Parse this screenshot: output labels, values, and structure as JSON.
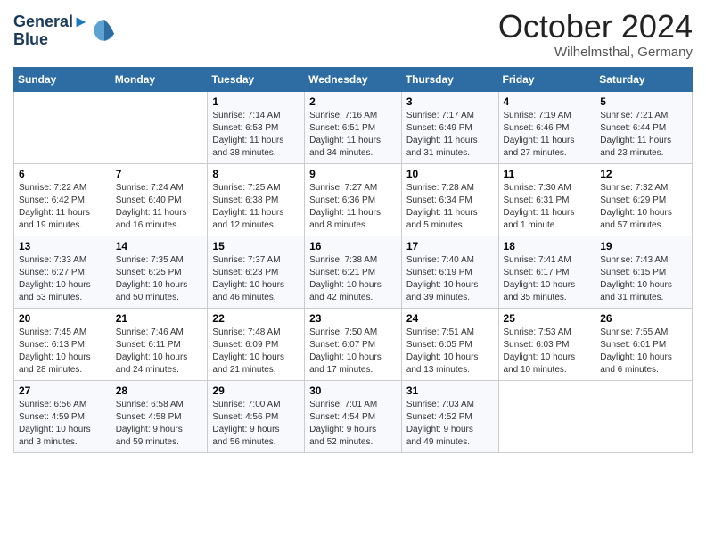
{
  "header": {
    "logo_line1": "General",
    "logo_line2": "Blue",
    "month": "October 2024",
    "location": "Wilhelmsthal, Germany"
  },
  "weekdays": [
    "Sunday",
    "Monday",
    "Tuesday",
    "Wednesday",
    "Thursday",
    "Friday",
    "Saturday"
  ],
  "weeks": [
    [
      {
        "day": "",
        "info": ""
      },
      {
        "day": "",
        "info": ""
      },
      {
        "day": "1",
        "info": "Sunrise: 7:14 AM\nSunset: 6:53 PM\nDaylight: 11 hours\nand 38 minutes."
      },
      {
        "day": "2",
        "info": "Sunrise: 7:16 AM\nSunset: 6:51 PM\nDaylight: 11 hours\nand 34 minutes."
      },
      {
        "day": "3",
        "info": "Sunrise: 7:17 AM\nSunset: 6:49 PM\nDaylight: 11 hours\nand 31 minutes."
      },
      {
        "day": "4",
        "info": "Sunrise: 7:19 AM\nSunset: 6:46 PM\nDaylight: 11 hours\nand 27 minutes."
      },
      {
        "day": "5",
        "info": "Sunrise: 7:21 AM\nSunset: 6:44 PM\nDaylight: 11 hours\nand 23 minutes."
      }
    ],
    [
      {
        "day": "6",
        "info": "Sunrise: 7:22 AM\nSunset: 6:42 PM\nDaylight: 11 hours\nand 19 minutes."
      },
      {
        "day": "7",
        "info": "Sunrise: 7:24 AM\nSunset: 6:40 PM\nDaylight: 11 hours\nand 16 minutes."
      },
      {
        "day": "8",
        "info": "Sunrise: 7:25 AM\nSunset: 6:38 PM\nDaylight: 11 hours\nand 12 minutes."
      },
      {
        "day": "9",
        "info": "Sunrise: 7:27 AM\nSunset: 6:36 PM\nDaylight: 11 hours\nand 8 minutes."
      },
      {
        "day": "10",
        "info": "Sunrise: 7:28 AM\nSunset: 6:34 PM\nDaylight: 11 hours\nand 5 minutes."
      },
      {
        "day": "11",
        "info": "Sunrise: 7:30 AM\nSunset: 6:31 PM\nDaylight: 11 hours\nand 1 minute."
      },
      {
        "day": "12",
        "info": "Sunrise: 7:32 AM\nSunset: 6:29 PM\nDaylight: 10 hours\nand 57 minutes."
      }
    ],
    [
      {
        "day": "13",
        "info": "Sunrise: 7:33 AM\nSunset: 6:27 PM\nDaylight: 10 hours\nand 53 minutes."
      },
      {
        "day": "14",
        "info": "Sunrise: 7:35 AM\nSunset: 6:25 PM\nDaylight: 10 hours\nand 50 minutes."
      },
      {
        "day": "15",
        "info": "Sunrise: 7:37 AM\nSunset: 6:23 PM\nDaylight: 10 hours\nand 46 minutes."
      },
      {
        "day": "16",
        "info": "Sunrise: 7:38 AM\nSunset: 6:21 PM\nDaylight: 10 hours\nand 42 minutes."
      },
      {
        "day": "17",
        "info": "Sunrise: 7:40 AM\nSunset: 6:19 PM\nDaylight: 10 hours\nand 39 minutes."
      },
      {
        "day": "18",
        "info": "Sunrise: 7:41 AM\nSunset: 6:17 PM\nDaylight: 10 hours\nand 35 minutes."
      },
      {
        "day": "19",
        "info": "Sunrise: 7:43 AM\nSunset: 6:15 PM\nDaylight: 10 hours\nand 31 minutes."
      }
    ],
    [
      {
        "day": "20",
        "info": "Sunrise: 7:45 AM\nSunset: 6:13 PM\nDaylight: 10 hours\nand 28 minutes."
      },
      {
        "day": "21",
        "info": "Sunrise: 7:46 AM\nSunset: 6:11 PM\nDaylight: 10 hours\nand 24 minutes."
      },
      {
        "day": "22",
        "info": "Sunrise: 7:48 AM\nSunset: 6:09 PM\nDaylight: 10 hours\nand 21 minutes."
      },
      {
        "day": "23",
        "info": "Sunrise: 7:50 AM\nSunset: 6:07 PM\nDaylight: 10 hours\nand 17 minutes."
      },
      {
        "day": "24",
        "info": "Sunrise: 7:51 AM\nSunset: 6:05 PM\nDaylight: 10 hours\nand 13 minutes."
      },
      {
        "day": "25",
        "info": "Sunrise: 7:53 AM\nSunset: 6:03 PM\nDaylight: 10 hours\nand 10 minutes."
      },
      {
        "day": "26",
        "info": "Sunrise: 7:55 AM\nSunset: 6:01 PM\nDaylight: 10 hours\nand 6 minutes."
      }
    ],
    [
      {
        "day": "27",
        "info": "Sunrise: 6:56 AM\nSunset: 4:59 PM\nDaylight: 10 hours\nand 3 minutes."
      },
      {
        "day": "28",
        "info": "Sunrise: 6:58 AM\nSunset: 4:58 PM\nDaylight: 9 hours\nand 59 minutes."
      },
      {
        "day": "29",
        "info": "Sunrise: 7:00 AM\nSunset: 4:56 PM\nDaylight: 9 hours\nand 56 minutes."
      },
      {
        "day": "30",
        "info": "Sunrise: 7:01 AM\nSunset: 4:54 PM\nDaylight: 9 hours\nand 52 minutes."
      },
      {
        "day": "31",
        "info": "Sunrise: 7:03 AM\nSunset: 4:52 PM\nDaylight: 9 hours\nand 49 minutes."
      },
      {
        "day": "",
        "info": ""
      },
      {
        "day": "",
        "info": ""
      }
    ]
  ]
}
